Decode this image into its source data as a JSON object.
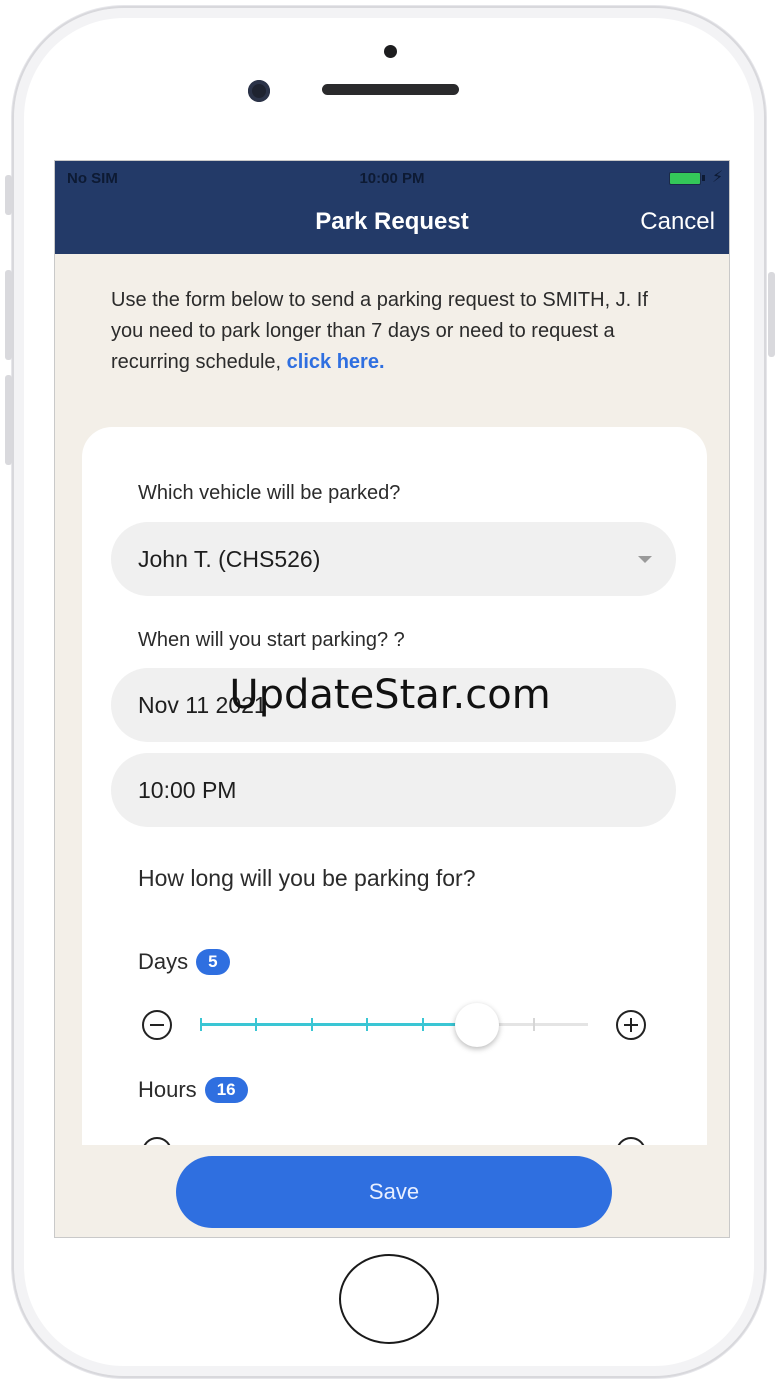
{
  "status_bar": {
    "carrier": "No SIM",
    "time": "10:00 PM"
  },
  "navbar": {
    "title": "Park Request",
    "cancel_label": "Cancel"
  },
  "intro": {
    "text": "Use the form below to send a parking request to SMITH, J. If you need to park longer than 7 days or need to request a recurring schedule, ",
    "link_text": "click here."
  },
  "form": {
    "vehicle_label": "Which vehicle will be parked?",
    "vehicle_value": "John T. (CHS526)",
    "start_label": "When will you start parking? ?",
    "start_date": "Nov 11 2021",
    "start_time": "10:00 PM",
    "duration_question": "How long will you be parking for?",
    "days_label": "Days",
    "days_value": "5",
    "days_max": 7,
    "hours_label": "Hours",
    "hours_value": "16"
  },
  "save_label": "Save",
  "watermark": "UpdateStar.com",
  "colors": {
    "navbar": "#233a68",
    "accent": "#2f6fe0",
    "slider_fill": "#3ac6d4",
    "battery": "#34c759"
  }
}
